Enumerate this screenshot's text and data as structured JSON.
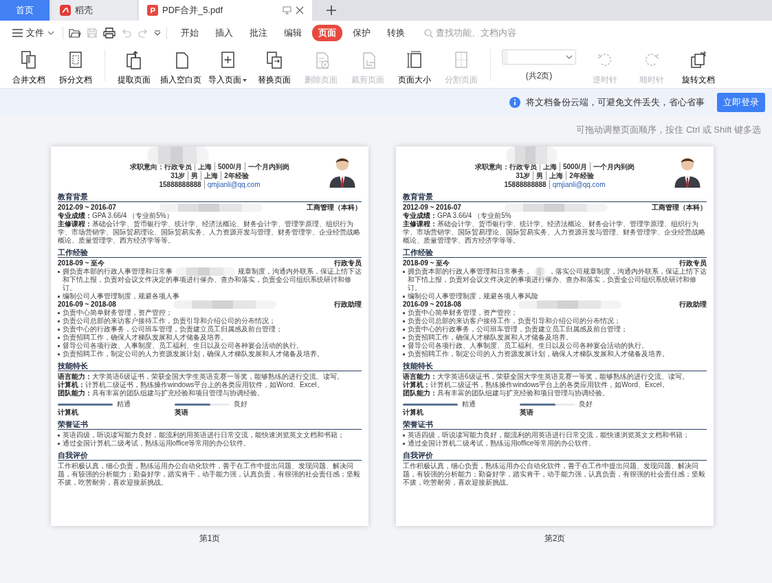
{
  "tabs": [
    {
      "kind": "home",
      "label": "首页",
      "selected": false
    },
    {
      "kind": "app",
      "label": "稻壳",
      "selected": false
    },
    {
      "kind": "document",
      "label": "PDF合并_5.pdf",
      "selected": true
    }
  ],
  "menu": {
    "file_label": "文件",
    "items": [
      {
        "label": "开始",
        "selected": false
      },
      {
        "label": "插入",
        "selected": false
      },
      {
        "label": "批注",
        "selected": false
      },
      {
        "label": "编辑",
        "selected": false
      },
      {
        "label": "页面",
        "selected": true
      },
      {
        "label": "保护",
        "selected": false
      },
      {
        "label": "转换",
        "selected": false
      }
    ],
    "search_placeholder": "查找功能、文档内容"
  },
  "ribbon": [
    [
      {
        "kind": "tool",
        "label": "合并文档",
        "disabled": false
      },
      {
        "kind": "tool",
        "label": "拆分文档",
        "disabled": false
      }
    ],
    [
      {
        "kind": "tool",
        "label": "提取页面",
        "disabled": false
      },
      {
        "kind": "tool",
        "label": "插入空白页",
        "disabled": false
      },
      {
        "kind": "dropdown",
        "label": "导入页面",
        "disabled": false
      },
      {
        "kind": "tool",
        "label": "替换页面",
        "disabled": false
      },
      {
        "kind": "tool",
        "label": "删除页面",
        "disabled": true
      },
      {
        "kind": "tool",
        "label": "裁剪页面",
        "disabled": true
      },
      {
        "kind": "tool",
        "label": "页面大小",
        "disabled": false
      },
      {
        "kind": "tool",
        "label": "分割页面",
        "disabled": true
      }
    ],
    [
      {
        "kind": "page-select",
        "label": "(共2页)",
        "disabled": false
      },
      {
        "kind": "tool",
        "label": "逆时针",
        "disabled": true
      },
      {
        "kind": "tool",
        "label": "顺时针",
        "disabled": true
      },
      {
        "kind": "tool",
        "label": "旋转文档",
        "disabled": false
      }
    ]
  ],
  "notice": {
    "text": "将文档备份云端，可避免文件丢失，省心省事",
    "button": "立即登录"
  },
  "hint": "可拖动调整页面顺序，按住 Ctrl 或 Shift 键多选",
  "pages": [
    {
      "caption": "第1页",
      "document": {
        "name_hidden": true,
        "header": [
          [
            {
              "kind": "text",
              "text": "求职意向：行政专员"
            },
            {
              "kind": "text",
              "text": "上海"
            },
            {
              "kind": "text",
              "text": "5000/月"
            },
            {
              "kind": "text",
              "text": "一个月内到岗"
            }
          ],
          [
            {
              "kind": "text",
              "text": "31岁"
            },
            {
              "kind": "text",
              "text": "男"
            },
            {
              "kind": "text",
              "text": "上海"
            },
            {
              "kind": "text",
              "text": "2年经验"
            }
          ],
          [
            {
              "kind": "text",
              "text": "15888888888"
            },
            {
              "kind": "email",
              "text": "qmjianli@qq.com"
            }
          ]
        ],
        "sections": [
          {
            "title": "教育背景",
            "blocks": [
              {
                "kind": "entry",
                "date": "2012-09 ~ 2016-07",
                "role": "工商管理（本科）",
                "blurred": true
              },
              {
                "kind": "para",
                "text": "**专业成绩：**GPA 3.66/4 （专业前5%）"
              },
              {
                "kind": "para",
                "text": "**主修课程：**基础会计学、货币银行学、统计学、经济法概论、财务会计学、管理学原理、组织行为学、市场营销学、国际贸易理论、国际贸易实务、人力资源开发与管理、财务管理学、企业经营战略概论、质量管理学、西方经济学等等。"
              }
            ]
          },
          {
            "title": "工作经验",
            "blocks": [
              {
                "kind": "entry",
                "date": "2018-09 ~ 至今",
                "role": "行政专员",
                "blurred": false
              },
              {
                "kind": "bullets",
                "items": [
                  {
                    "kind": "cut",
                    "left": "拥负责本部的行政人事管理和日常事",
                    "right": "规章制度，沟通内外联系，保证上情下达",
                    "rest": "和下情上报，负责对会议文件决定的事项进行催办、查办和落实，负责全公司组织系统研讨和修订。"
                  },
                  {
                    "kind": "text",
                    "text": "编制公司人事管理制度，规避各项人事"
                  }
                ]
              },
              {
                "kind": "entry",
                "date": "2016-09 ~ 2018-08",
                "role": "行政助理",
                "blurred": true
              },
              {
                "kind": "bullets",
                "items": [
                  {
                    "kind": "text",
                    "text": "负责中心简单财务管理，资产管控；"
                  },
                  {
                    "kind": "text",
                    "text": "负责公司总部的来访客户接待工作，负责引导和介绍公司的分布情况；"
                  },
                  {
                    "kind": "text",
                    "text": "负责中心的行政事务，公司班车管理，负责建立员工归属感及前台管理；"
                  },
                  {
                    "kind": "text",
                    "text": "负责招聘工作，确保人才梯队发展和人才储备及培养。"
                  },
                  {
                    "kind": "text",
                    "text": "督导公司各项行政、人事制度、员工福利、生日以及公司各种宴会活动的执行。"
                  },
                  {
                    "kind": "text",
                    "text": "负责招聘工作，制定公司的人力资源发展计划，确保人才梯队发展和人才储备及培养。"
                  }
                ]
              }
            ]
          },
          {
            "title": "技能特长",
            "blocks": [
              {
                "kind": "para",
                "text": "**语言能力：**大学英语6级证书，荣获全国大学生英语竞赛一等奖，能够熟练的进行交流、读写。"
              },
              {
                "kind": "para",
                "text": "**计算机：**计算机二级证书，熟练操作windows平台上的各类应用软件，如Word、Excel。"
              },
              {
                "kind": "para",
                "text": "**团队能力：**具有丰富的团队组建与扩充经验和项目管理与协调经验。"
              },
              {
                "kind": "skills",
                "items": [
                  {
                    "name": "计算机",
                    "rating": "精通",
                    "level": 1.0
                  },
                  {
                    "name": "英语",
                    "rating": "良好",
                    "level": 0.65
                  }
                ]
              }
            ]
          },
          {
            "title": "荣誉证书",
            "blocks": [
              {
                "kind": "bullets",
                "items": [
                  {
                    "kind": "text",
                    "text": "英语四级，听说读写能力良好，能流利的用英语进行日常交流，能快速浏览英文文档和书籍；"
                  },
                  {
                    "kind": "text",
                    "text": "通过全国计算机二级考试，熟练运用office等常用的办公软件。"
                  }
                ]
              }
            ]
          },
          {
            "title": "自我评价",
            "blocks": [
              {
                "kind": "para",
                "text": "工作积极认真，细心负责，熟练运用办公自动化软件，善于在工作中提出问题、发现问题、解决问题，有较强的分析能力；勤奋好学，踏实肯干，动手能力强，认真负责，有很强的社会责任感；坚毅不拔，吃苦耐劳，喜欢迎接新挑战。"
              }
            ]
          }
        ]
      }
    },
    {
      "caption": "第2页",
      "document": {
        "name_hidden": true,
        "header": [
          [
            {
              "kind": "text",
              "text": "求职意向：行政专员"
            },
            {
              "kind": "text",
              "text": "上海"
            },
            {
              "kind": "text",
              "text": "5000/月"
            },
            {
              "kind": "text",
              "text": "一个月内到岗"
            }
          ],
          [
            {
              "kind": "text",
              "text": "31岁"
            },
            {
              "kind": "text",
              "text": "男"
            },
            {
              "kind": "text",
              "text": "上海"
            },
            {
              "kind": "text",
              "text": "2年经验"
            }
          ],
          [
            {
              "kind": "text",
              "text": "15888888888"
            },
            {
              "kind": "email",
              "text": "qmjianli@qq.com"
            }
          ]
        ],
        "sections": [
          {
            "title": "教育背景",
            "blocks": [
              {
                "kind": "entry",
                "date": "2012-09 ~ 2016-07",
                "role": "工商管理（本科）",
                "blurred": true
              },
              {
                "kind": "para",
                "text": "**专业成绩：**GPA 3.66/4 （专业前5%"
              },
              {
                "kind": "para",
                "text": "**主修课程：**基础会计学、货币银行学、统计学、经济法概论、财务会计学、管理学原理、组织行为学、市场营销学、国际贸易理论、国际贸易实务、人力资源开发与管理、财务管理学、企业经营战略概论、质量管理学、西方经济学等等。"
              }
            ]
          },
          {
            "title": "工作经验",
            "blocks": [
              {
                "kind": "entry",
                "date": "2018-09 ~ 至今",
                "role": "行政专员",
                "blurred": false
              },
              {
                "kind": "bullets",
                "items": [
                  {
                    "kind": "cut",
                    "left": "拥负责本部的行政人事管理和日常事务，",
                    "right": "，落实公司规章制度，沟通内外联系，保证上情下达",
                    "rest": "和下情上报，负责对会议文件决定的事项进行催办、查办和落实，负责全公司组织系统研讨和修订。"
                  },
                  {
                    "kind": "text",
                    "text": "编制公司人事管理制度，规避各项人事风险"
                  }
                ]
              },
              {
                "kind": "entry",
                "date": "2016-09 ~ 2018-08",
                "role": "行政助理",
                "blurred": true
              },
              {
                "kind": "bullets",
                "items": [
                  {
                    "kind": "text",
                    "text": "负责中心简单财务管理，资产管控；"
                  },
                  {
                    "kind": "text",
                    "text": "负责公司总部的来访客户接待工作，负责引导和介绍公司的分布情况；"
                  },
                  {
                    "kind": "text",
                    "text": "负责中心的行政事务，公司班车管理，负责建立员工归属感及前台管理；"
                  },
                  {
                    "kind": "text",
                    "text": "负责招聘工作，确保人才梯队发展和人才储备及培养。"
                  },
                  {
                    "kind": "text",
                    "text": "督导公司各项行政、人事制度、员工福利、生日以及公司各种宴会活动的执行。"
                  },
                  {
                    "kind": "text",
                    "text": "负责招聘工作，制定公司的人力资源发展计划，确保人才梯队发展和人才储备及培养。"
                  }
                ]
              }
            ]
          },
          {
            "title": "技能特长",
            "blocks": [
              {
                "kind": "para",
                "text": "**语言能力：**大学英语6级证书，荣获全国大学生英语竞赛一等奖，能够熟练的进行交流、读写。"
              },
              {
                "kind": "para",
                "text": "**计算机：**计算机二级证书，熟练操作windows平台上的各类应用软件，如Word、Excel。"
              },
              {
                "kind": "para",
                "text": "**团队能力：**具有丰富的团队组建与扩充经验和项目管理与协调经验。"
              },
              {
                "kind": "skills",
                "items": [
                  {
                    "name": "计算机",
                    "rating": "精通",
                    "level": 1.0
                  },
                  {
                    "name": "英语",
                    "rating": "良好",
                    "level": 0.65
                  }
                ]
              }
            ]
          },
          {
            "title": "荣誉证书",
            "blocks": [
              {
                "kind": "bullets",
                "items": [
                  {
                    "kind": "text",
                    "text": "英语四级，听说读写能力良好，能流利的用英语进行日常交流，能快速浏览英文文档和书籍；"
                  },
                  {
                    "kind": "text",
                    "text": "通过全国计算机二级考试，熟练运用office等常用的办公软件。"
                  }
                ]
              }
            ]
          },
          {
            "title": "自我评价",
            "blocks": [
              {
                "kind": "para",
                "text": "工作积极认真，细心负责，熟练运用办公自动化软件，善于在工作中提出问题、发现问题、解决问题，有较强的分析能力；勤奋好学，踏实肯干，动手能力强，认真负责，有很强的社会责任感；坚毅不拔，吃苦耐劳，喜欢迎接新挑战。"
              }
            ]
          }
        ]
      }
    }
  ]
}
